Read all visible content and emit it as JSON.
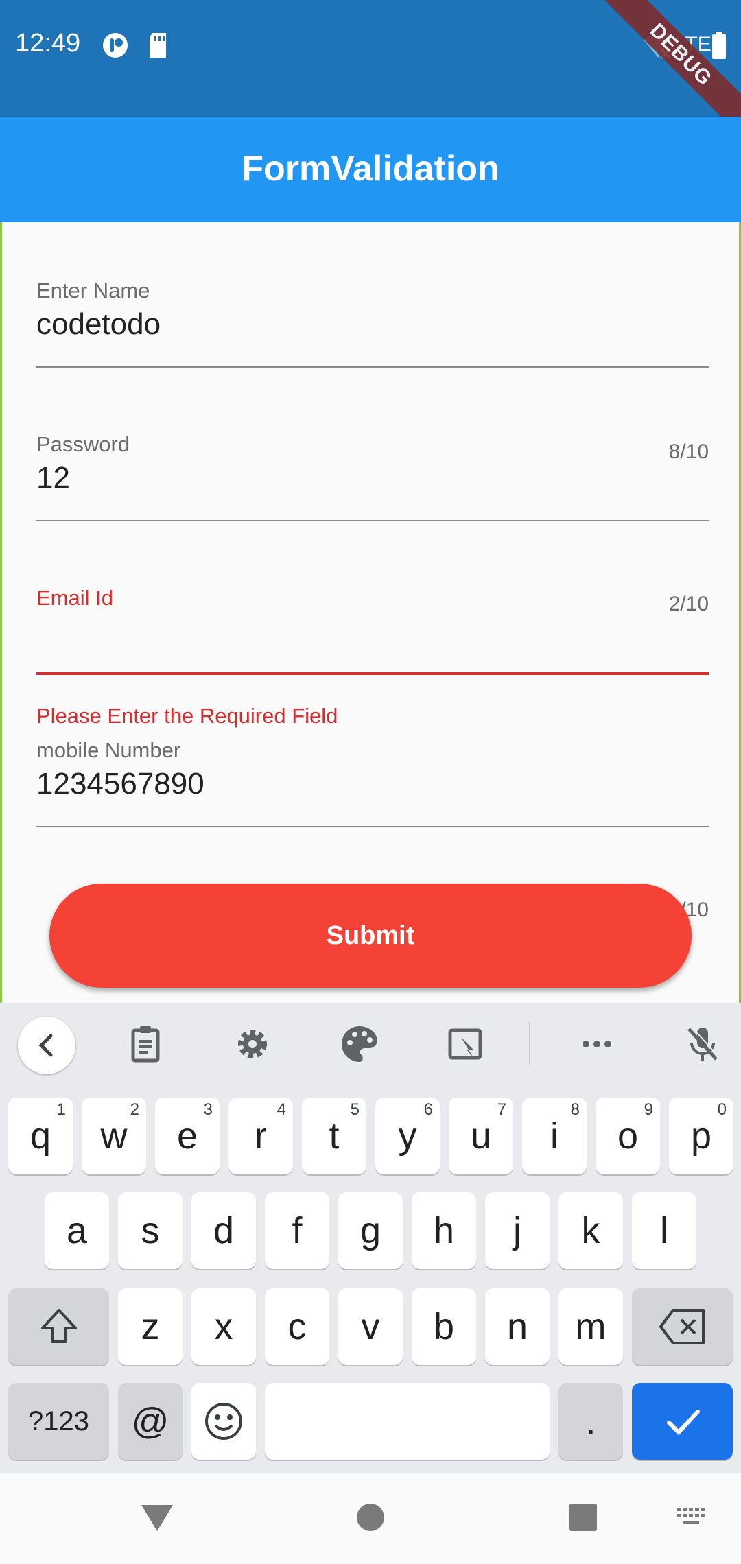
{
  "status_bar": {
    "time": "12:49",
    "network": "LTE",
    "debug_banner": "DEBUG",
    "icons": [
      "app-notification-icon",
      "sd-card-icon",
      "wifi-off-icon",
      "battery-icon"
    ]
  },
  "app_bar": {
    "title": "FormValidation"
  },
  "form": {
    "name": {
      "label": "Enter Name",
      "value": "codetodo",
      "counter": "8/10"
    },
    "password": {
      "label": "Password",
      "value": "12",
      "counter": "2/10"
    },
    "email": {
      "label": "Email Id",
      "value": "",
      "error": "Please Enter the Required Field"
    },
    "mobile": {
      "label": "mobile Number",
      "value": "1234567890",
      "counter": "10/10"
    },
    "submit_label": "Submit"
  },
  "keyboard": {
    "toolbar_icons": [
      "back-chevron-icon",
      "clipboard-icon",
      "settings-gear-icon",
      "palette-icon",
      "floating-keyboard-icon",
      "more-icon",
      "mic-off-icon"
    ],
    "row1": [
      {
        "k": "q",
        "h": "1"
      },
      {
        "k": "w",
        "h": "2"
      },
      {
        "k": "e",
        "h": "3"
      },
      {
        "k": "r",
        "h": "4"
      },
      {
        "k": "t",
        "h": "5"
      },
      {
        "k": "y",
        "h": "6"
      },
      {
        "k": "u",
        "h": "7"
      },
      {
        "k": "i",
        "h": "8"
      },
      {
        "k": "o",
        "h": "9"
      },
      {
        "k": "p",
        "h": "0"
      }
    ],
    "row2": [
      "a",
      "s",
      "d",
      "f",
      "g",
      "h",
      "j",
      "k",
      "l"
    ],
    "row3": [
      "z",
      "x",
      "c",
      "v",
      "b",
      "n",
      "m"
    ],
    "symbols_label": "?123",
    "at_label": "@",
    "period_label": "."
  },
  "colors": {
    "status_bar": "#1f73b7",
    "app_bar": "#2196f3",
    "error": "#d32f2f",
    "submit": "#f44336",
    "keyboard_action": "#1a73e8"
  }
}
